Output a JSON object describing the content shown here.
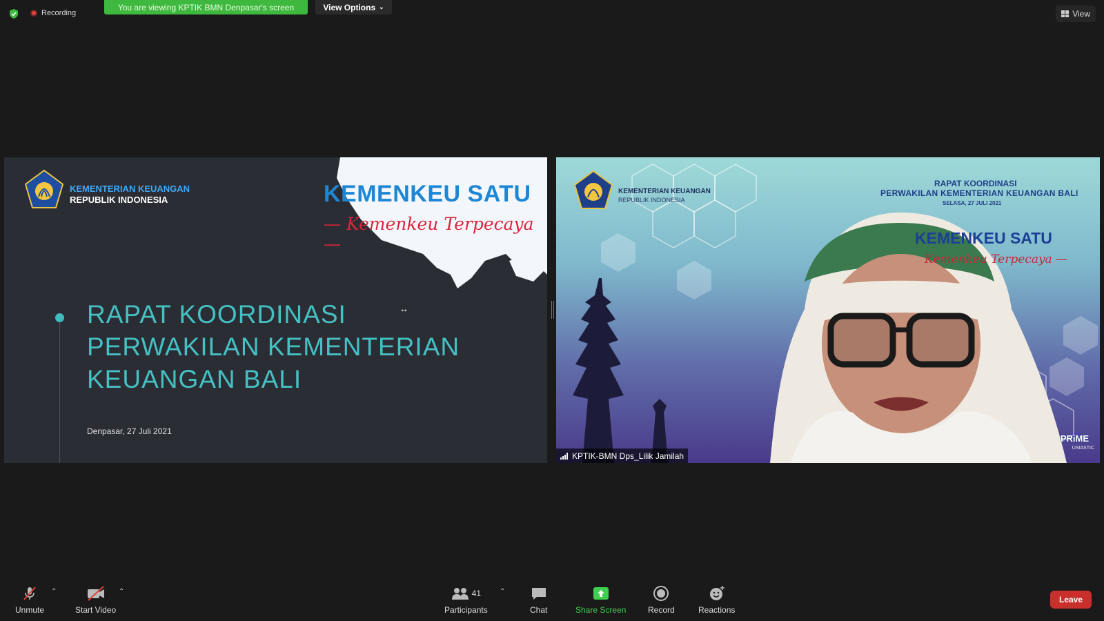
{
  "top_bar": {
    "recording_label": "Recording",
    "viewing_banner": "You are viewing KPTIK BMN Denpasar's screen",
    "view_options_label": "View Options",
    "view_label": "View"
  },
  "slide": {
    "org_line1": "KEMENTERIAN KEUANGAN",
    "org_line2": "REPUBLIK INDONESIA",
    "brand_title": "KEMENKEU SATU",
    "brand_tagline": "— Kemenkeu Terpecaya —",
    "heading_lines": [
      "RAPAT KOORDINASI",
      "PERWAKILAN KEMENTERIAN",
      "KEUANGAN BALI"
    ],
    "date_line": "Denpasar, 27 Juli 2021"
  },
  "video": {
    "org_line1": "KEMENTERIAN KEUANGAN",
    "org_line2": "REPUBLIK INDONESIA",
    "rk_line1": "RAPAT KOORDINASI",
    "rk_line2": "PERWAKILAN KEMENTERIAN KEUANGAN BALI",
    "rk_line3": "SELASA, 27 JULI 2021",
    "brand_title": "KEMENKEU SATU",
    "brand_tagline": "Kemenkeu Terpecaya —",
    "prime_label": "PRiME",
    "prime_sub": "USIASTIC",
    "participant_name": "KPTIK-BMN Dps_Lilik Jamilah"
  },
  "toolbar": {
    "unmute_label": "Unmute",
    "start_video_label": "Start Video",
    "participants_label": "Participants",
    "participants_count": "41",
    "chat_label": "Chat",
    "share_screen_label": "Share Screen",
    "record_label": "Record",
    "reactions_label": "Reactions",
    "leave_label": "Leave"
  },
  "colors": {
    "banner_green": "#3fb83f",
    "slide_accent": "#45c1c4",
    "leave_red": "#c9302c",
    "share_green": "#3fcf4f"
  }
}
